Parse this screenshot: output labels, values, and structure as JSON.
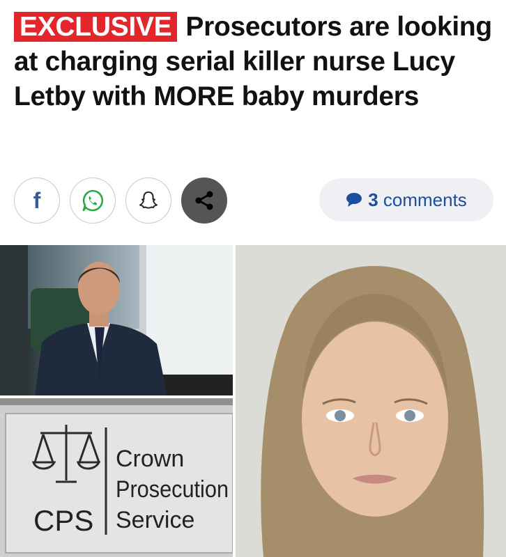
{
  "article": {
    "badge": "EXCLUSIVE",
    "headline": "Prosecutors are looking at charging serial killer nurse Lucy Letby with MORE baby murders"
  },
  "share": {
    "facebook_icon": "facebook-icon",
    "whatsapp_icon": "whatsapp-icon",
    "snapchat_icon": "snapchat-icon",
    "share_icon": "share-icon",
    "comments_count": "3",
    "comments_label": "comments",
    "comments_icon": "comment-bubble-icon",
    "colors": {
      "badge": "#e3262c",
      "comments_text": "#1c4fa0",
      "comments_bg": "#eef0f3"
    }
  },
  "photos": {
    "sign": {
      "line1": "Crown",
      "line2": "Prosecution",
      "line3": "Service",
      "abbr": "CPS"
    }
  }
}
